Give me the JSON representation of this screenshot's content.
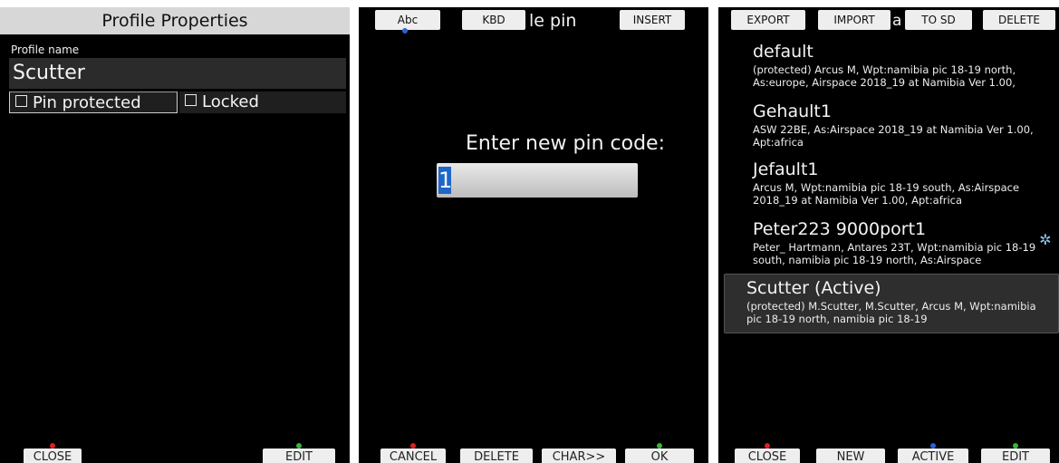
{
  "panel1": {
    "title": "Profile Properties",
    "name_label": "Profile name",
    "name_value": "Scutter",
    "pin_protected_label": "Pin protected",
    "locked_label": "Locked",
    "buttons": {
      "close": "CLOSE",
      "edit": "EDIT"
    }
  },
  "panel2": {
    "title_visible": "le pin",
    "top_buttons": {
      "abc": "Abc",
      "kbd": "KBD",
      "insert": "INSERT"
    },
    "prompt": "Enter new pin code:",
    "pin_value": "1",
    "buttons": {
      "cancel": "CANCEL",
      "delete": "DELETE",
      "char": "CHAR>>",
      "ok": "OK"
    }
  },
  "panel3": {
    "title_visible": "a",
    "top_buttons": {
      "export": "EXPORT",
      "import": "IMPORT",
      "to_sd": "TO SD",
      "delete": "DELETE"
    },
    "profiles": [
      {
        "name": "default",
        "desc": "(protected) Arcus M, Wpt:namibia pic 18-19 north, As:europe, Airspace 2018_19 at Namibia Ver 1.00,"
      },
      {
        "name": "Gehault1",
        "desc": "ASW 22BE, As:Airspace 2018_19 at Namibia Ver 1.00, Apt:africa"
      },
      {
        "name": "Jefault1",
        "desc": "Arcus M, Wpt:namibia pic 18-19 south, As:Airspace 2018_19 at Namibia Ver 1.00, Apt:africa"
      },
      {
        "name": "Peter223 9000port1",
        "desc": "Peter_ Hartmann, Antares 23T, Wpt:namibia pic 18-19 south, namibia pic 18-19 north, As:Airspace"
      },
      {
        "name": "Scutter (Active)",
        "desc": "(protected) M.Scutter, M.Scutter, Arcus M, Wpt:namibia pic 18-19 north, namibia pic 18-19"
      }
    ],
    "buttons": {
      "close": "CLOSE",
      "new": "NEW",
      "active": "ACTIVE",
      "edit": "EDIT"
    }
  },
  "colors": {
    "led_red": "#e0201c",
    "led_green": "#3cb43c",
    "led_blue": "#2a62d8",
    "cursor_blue": "#1e67c9"
  },
  "icons": {
    "sync": "sync-icon"
  }
}
